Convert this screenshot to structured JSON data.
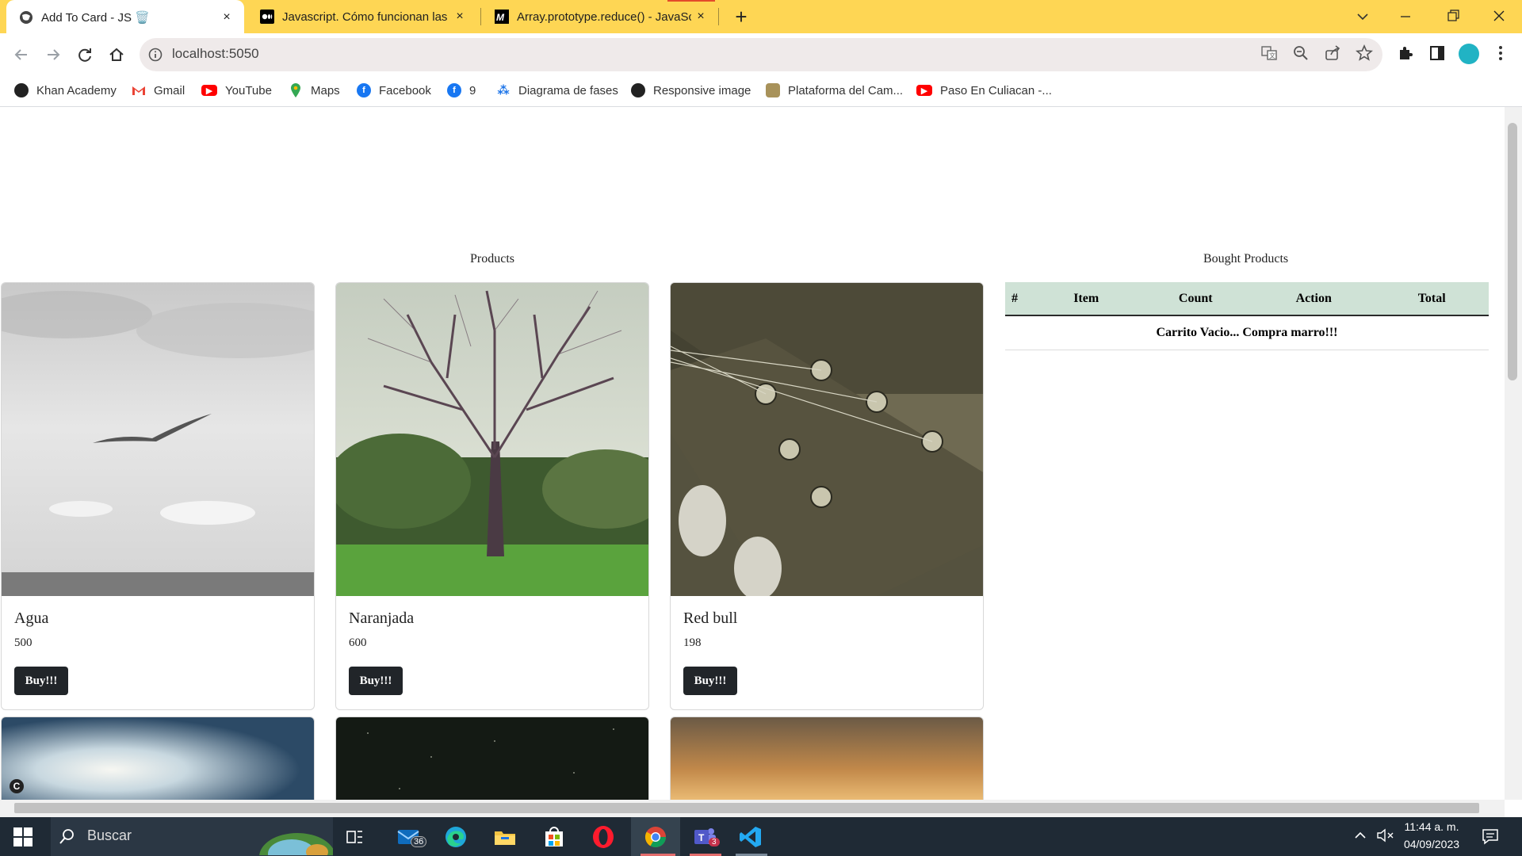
{
  "browser": {
    "tabs": [
      {
        "title": "Add To Card - JS 🗑️",
        "active": true
      },
      {
        "title": "Javascript. Cómo funcionan las co",
        "active": false
      },
      {
        "title": "Array.prototype.reduce() - JavaSc",
        "active": false
      }
    ],
    "new_tab_label": "+",
    "close_label": "×",
    "url": "localhost:5050",
    "bookmarks": [
      {
        "label": "Khan Academy",
        "icon": "khan-icon",
        "color": "#222"
      },
      {
        "label": "Gmail",
        "icon": "gmail-icon",
        "color": "#ea4335"
      },
      {
        "label": "YouTube",
        "icon": "youtube-icon",
        "color": "#ff0000"
      },
      {
        "label": "Maps",
        "icon": "maps-icon",
        "color": "#34a853"
      },
      {
        "label": "Facebook",
        "icon": "facebook-icon",
        "color": "#1877f2"
      },
      {
        "label": "9",
        "icon": "facebook-icon",
        "color": "#1877f2"
      },
      {
        "label": "Diagrama de fases",
        "icon": "diagram-icon",
        "color": "#1a73e8"
      },
      {
        "label": "Responsive image",
        "icon": "globe-icon",
        "color": "#222"
      },
      {
        "label": "Plataforma del Cam...",
        "icon": "shield-icon",
        "color": "#a8925a"
      },
      {
        "label": "Paso En Culiacan -...",
        "icon": "youtube-icon",
        "color": "#ff0000"
      }
    ]
  },
  "page": {
    "products_title": "Products",
    "cart_title": "Bought Products",
    "products": [
      {
        "name": "Agua",
        "price": "500",
        "buy_label": "Buy!!!"
      },
      {
        "name": "Naranjada",
        "price": "600",
        "buy_label": "Buy!!!"
      },
      {
        "name": "Red bull",
        "price": "198",
        "buy_label": "Buy!!!"
      }
    ],
    "cart": {
      "headers": [
        "#",
        "Item",
        "Count",
        "Action",
        "Total"
      ],
      "empty_message": "Carrito Vacio... Compra marro!!!"
    }
  },
  "taskbar": {
    "search_label": "Buscar",
    "mail_badge": "36",
    "teams_badge": "3",
    "time": "11:44 a. m.",
    "date": "04/09/2023"
  }
}
